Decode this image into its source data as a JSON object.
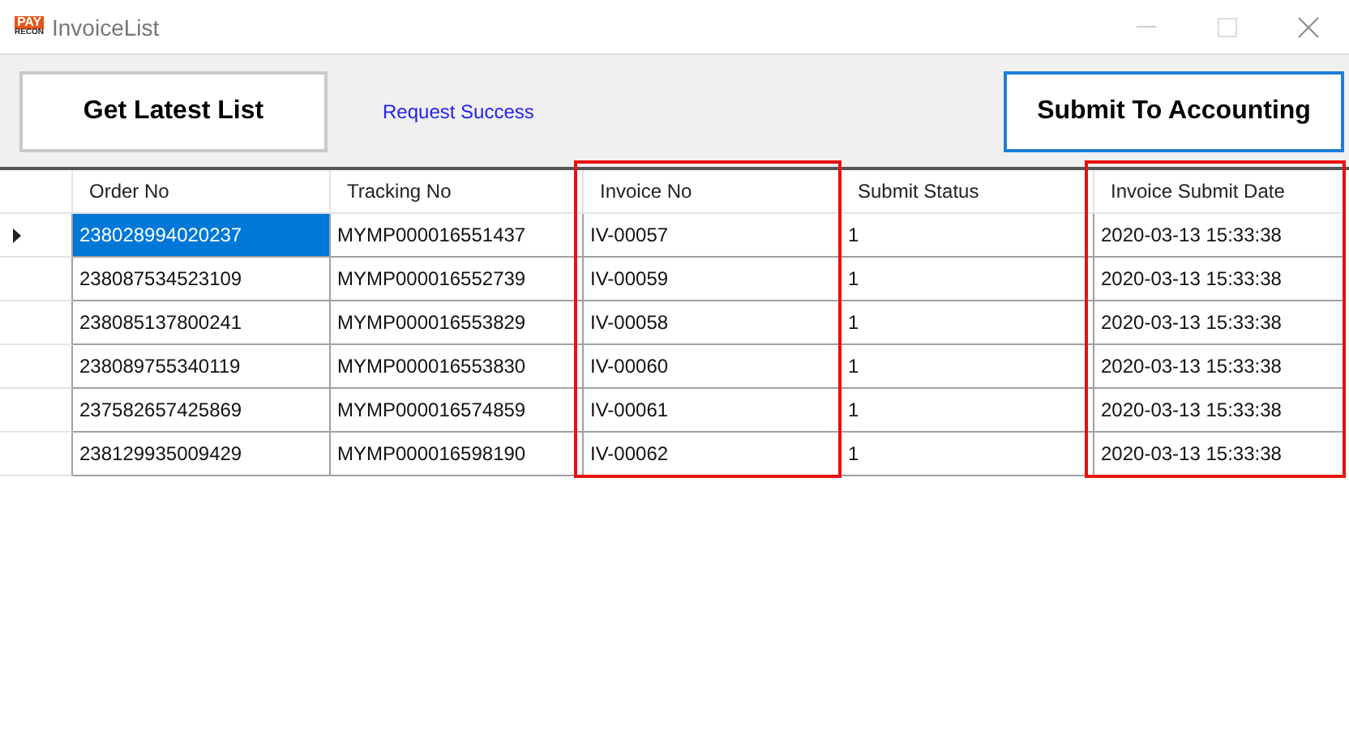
{
  "window": {
    "title": "InvoiceList",
    "logo": {
      "top": "PAY",
      "bottom": "RECON"
    }
  },
  "toolbar": {
    "get_button": {
      "label": "Get Latest List",
      "focused": false
    },
    "status": "Request Success",
    "submit_button": {
      "label": "Submit To Accounting",
      "focused": true
    }
  },
  "table": {
    "columns": [
      {
        "label": "Order No",
        "highlighted": false
      },
      {
        "label": "Tracking No",
        "highlighted": false
      },
      {
        "label": "Invoice No",
        "highlighted": true
      },
      {
        "label": "Submit Status",
        "highlighted": false
      },
      {
        "label": "Invoice Submit Date",
        "highlighted": true
      }
    ],
    "rows": [
      {
        "selected": true,
        "cells": [
          "238028994020237",
          "MYMP000016551437",
          "IV-00057",
          "1",
          "2020-03-13 15:33:38"
        ]
      },
      {
        "selected": false,
        "cells": [
          "238087534523109",
          "MYMP000016552739",
          "IV-00059",
          "1",
          "2020-03-13 15:33:38"
        ]
      },
      {
        "selected": false,
        "cells": [
          "238085137800241",
          "MYMP000016553829",
          "IV-00058",
          "1",
          "2020-03-13 15:33:38"
        ]
      },
      {
        "selected": false,
        "cells": [
          "238089755340119",
          "MYMP000016553830",
          "IV-00060",
          "1",
          "2020-03-13 15:33:38"
        ]
      },
      {
        "selected": false,
        "cells": [
          "237582657425869",
          "MYMP000016574859",
          "IV-00061",
          "1",
          "2020-03-13 15:33:38"
        ]
      },
      {
        "selected": false,
        "cells": [
          "238129935009429",
          "MYMP000016598190",
          "IV-00062",
          "1",
          "2020-03-13 15:33:38"
        ]
      }
    ]
  }
}
